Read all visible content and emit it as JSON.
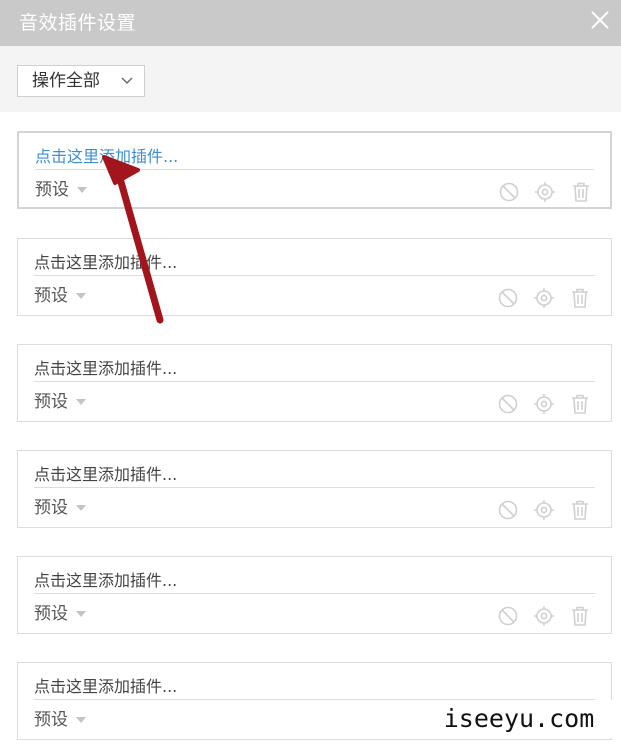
{
  "window": {
    "title": "音效插件设置",
    "close_icon": "close-icon"
  },
  "toolbar": {
    "operate_all_label": "操作全部"
  },
  "slots": [
    {
      "add_label": "点击这里添加插件...",
      "preset_label": "预设",
      "active": true
    },
    {
      "add_label": "点击这里添加插件...",
      "preset_label": "预设",
      "active": false
    },
    {
      "add_label": "点击这里添加插件...",
      "preset_label": "预设",
      "active": false
    },
    {
      "add_label": "点击这里添加插件...",
      "preset_label": "预设",
      "active": false
    },
    {
      "add_label": "点击这里添加插件...",
      "preset_label": "预设",
      "active": false
    },
    {
      "add_label": "点击这里添加插件...",
      "preset_label": "预设",
      "active": false
    }
  ],
  "slot_icons": [
    "disable-icon",
    "settings-icon",
    "trash-icon"
  ],
  "colors": {
    "titlebar": "#c9c9c9",
    "link_active": "#3d8ed1",
    "annotation_arrow": "#a3151c",
    "icon": "#d0d0d0"
  },
  "watermark": "iseeyu.com"
}
